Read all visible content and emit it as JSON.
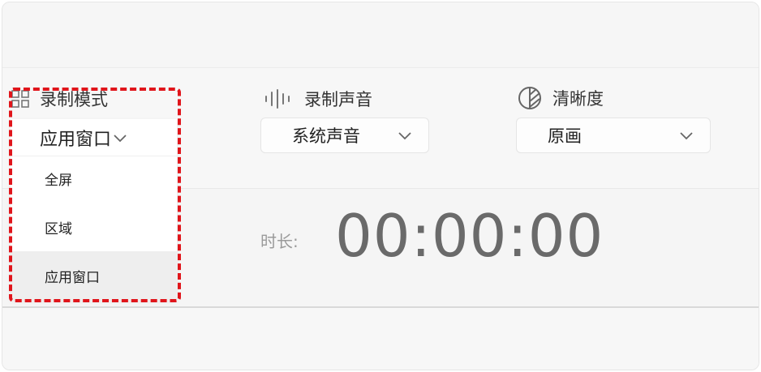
{
  "recording_mode": {
    "label": "录制模式",
    "icon": "grid-icon",
    "selected": "应用窗口",
    "options": [
      "全屏",
      "区域",
      "应用窗口"
    ]
  },
  "record_audio": {
    "label": "录制声音",
    "icon": "sound-wave-icon",
    "selected": "系统声音"
  },
  "clarity": {
    "label": "清晰度",
    "icon": "clarity-icon",
    "selected": "原画"
  },
  "timer": {
    "label": "时长:",
    "value": "00:00:00"
  },
  "colors": {
    "highlight": "#e0151b",
    "timer_text": "#6a6a6a"
  }
}
